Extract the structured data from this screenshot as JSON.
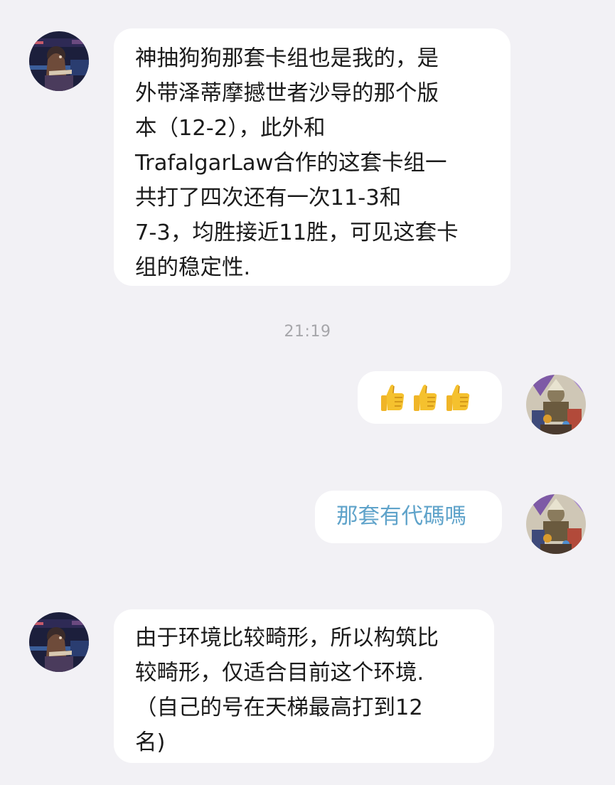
{
  "messages": [
    {
      "side": "left",
      "lines": [
        "神抽狗狗那套卡组也是我的，是",
        "外带泽蒂摩撼世者沙导的那个版",
        "本（12-2），此外和",
        "TrafalgarLaw合作的这套卡组一",
        "共打了四次还有一次11-3和",
        "7-3，均胜接近11胜，可见这套卡",
        "组的稳定性."
      ]
    },
    {
      "side": "right",
      "emoji": [
        "thumbs-up",
        "thumbs-up",
        "thumbs-up"
      ]
    },
    {
      "side": "right",
      "text": "那套有代碼嗎",
      "text_color": "#5fa3ca"
    },
    {
      "side": "left",
      "lines": [
        "由于环境比较畸形，所以构筑比",
        "较畸形，仅适合目前这个环境.",
        "（自己的号在天梯最高打到12",
        "名)"
      ]
    }
  ],
  "timestamp": "21:19",
  "colors": {
    "background": "#f2f1f5",
    "bubble": "#ffffff",
    "text": "#1b1b1b",
    "link": "#5fa3ca",
    "timestamp": "#a6a6aa"
  }
}
